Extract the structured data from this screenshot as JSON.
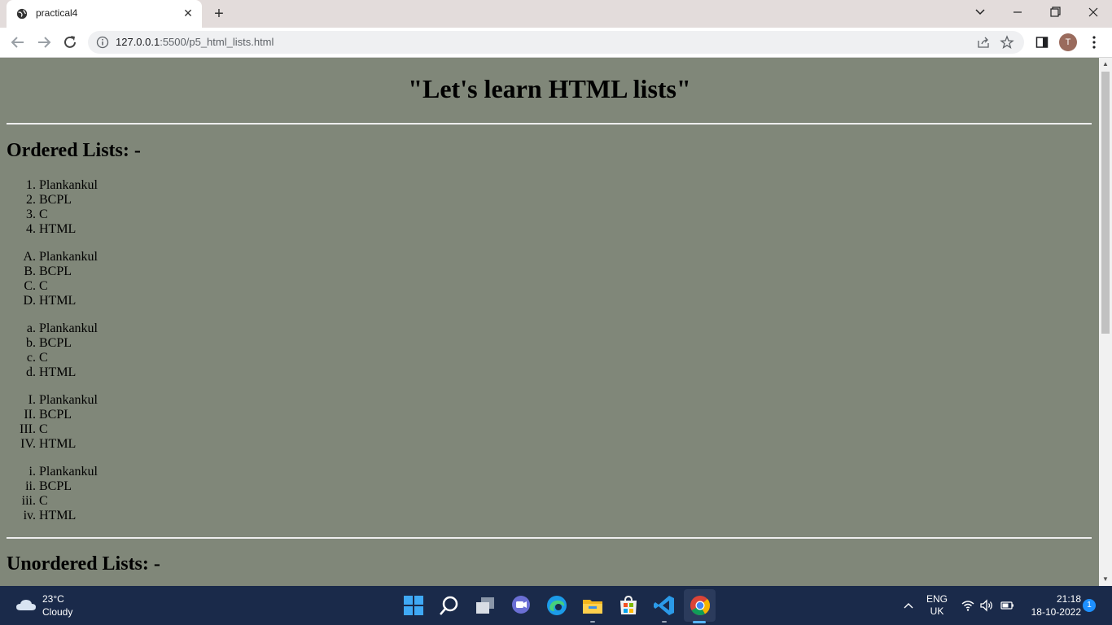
{
  "browser": {
    "tab_title": "practical4",
    "url_host": "127.0.0.1",
    "url_path": ":5500/p5_html_lists.html",
    "avatar_letter": "T"
  },
  "page": {
    "title": "\"Let's learn HTML lists\"",
    "ordered_heading": "Ordered Lists: -",
    "unordered_heading": "Unordered Lists: -",
    "lists": [
      {
        "markers": [
          "1.",
          "2.",
          "3.",
          "4."
        ],
        "items": [
          "Plankankul",
          "BCPL",
          "C",
          "HTML"
        ]
      },
      {
        "markers": [
          "A.",
          "B.",
          "C.",
          "D."
        ],
        "items": [
          "Plankankul",
          "BCPL",
          "C",
          "HTML"
        ]
      },
      {
        "markers": [
          "a.",
          "b.",
          "c.",
          "d."
        ],
        "items": [
          "Plankankul",
          "BCPL",
          "C",
          "HTML"
        ]
      },
      {
        "markers": [
          "I.",
          "II.",
          "III.",
          "IV."
        ],
        "items": [
          "Plankankul",
          "BCPL",
          "C",
          "HTML"
        ]
      },
      {
        "markers": [
          "i.",
          "ii.",
          "iii.",
          "iv."
        ],
        "items": [
          "Plankankul",
          "BCPL",
          "C",
          "HTML"
        ]
      }
    ]
  },
  "taskbar": {
    "temperature": "23°C",
    "weather": "Cloudy",
    "lang_top": "ENG",
    "lang_bottom": "UK",
    "time": "21:18",
    "date": "18-10-2022",
    "notifications": "1"
  },
  "colors": {
    "page_bg": "#808779",
    "taskbar_bg": "#1a2a4a"
  }
}
